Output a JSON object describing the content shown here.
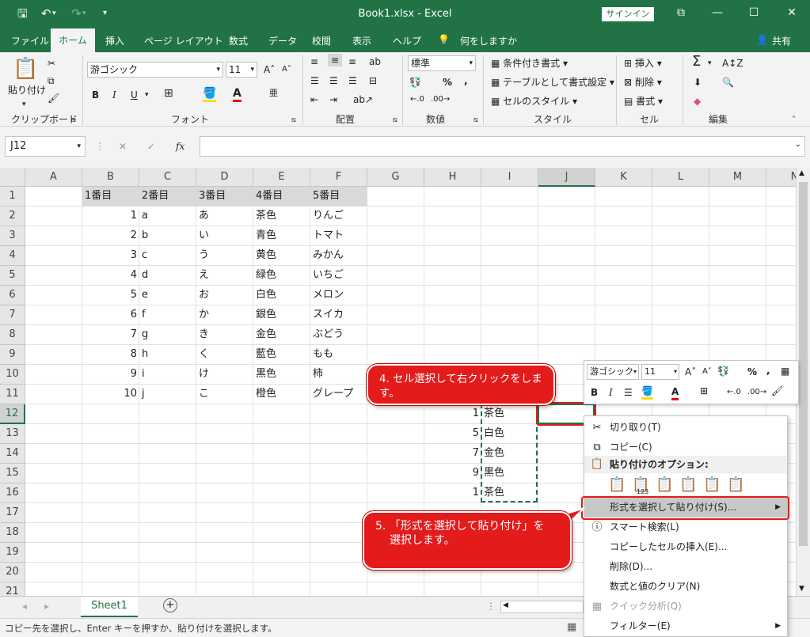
{
  "title_bar": {
    "title": "Book1.xlsx  -  Excel",
    "signin": "サインイン",
    "qat": {
      "save_icon": "save-icon",
      "undo_icon": "undo-icon",
      "redo_icon": "redo-icon",
      "customize": "▾"
    }
  },
  "menu": {
    "tabs": [
      "ファイル",
      "ホーム",
      "挿入",
      "ページ レイアウト",
      "数式",
      "データ",
      "校閲",
      "表示",
      "ヘルプ"
    ],
    "tell_me": "何をしますか",
    "share": "共有"
  },
  "ribbon": {
    "clipboard": {
      "paste": "貼り付け",
      "label": "クリップボード"
    },
    "font": {
      "name": "游ゴシック",
      "size": "11",
      "label": "フォント"
    },
    "alignment": {
      "label": "配置"
    },
    "number": {
      "format": "標準",
      "label": "数値",
      "percent": "%",
      "comma": ","
    },
    "styles": {
      "conditional": "条件付き書式",
      "table": "テーブルとして書式設定",
      "cell_styles": "セルのスタイル",
      "label": "スタイル"
    },
    "cells": {
      "insert": "挿入",
      "delete": "削除",
      "format": "書式",
      "label": "セル"
    },
    "editing": {
      "label": "編集"
    }
  },
  "formula_bar": {
    "name_box": "J12",
    "fx": "fx",
    "value": ""
  },
  "sheet": {
    "columns": [
      "A",
      "B",
      "C",
      "D",
      "E",
      "F",
      "G",
      "H",
      "I",
      "J",
      "K",
      "L",
      "M",
      "N"
    ],
    "rows": [
      "1",
      "2",
      "3",
      "4",
      "5",
      "6",
      "7",
      "8",
      "9",
      "10",
      "11",
      "12",
      "13",
      "14",
      "15",
      "16",
      "17",
      "18",
      "19",
      "20",
      "21"
    ],
    "header_row": [
      "1番目",
      "2番目",
      "3番目",
      "4番目",
      "5番目"
    ],
    "data": [
      [
        "1",
        "a",
        "あ",
        "茶色",
        "りんご"
      ],
      [
        "2",
        "b",
        "い",
        "青色",
        "トマト"
      ],
      [
        "3",
        "c",
        "う",
        "黄色",
        "みかん"
      ],
      [
        "4",
        "d",
        "え",
        "緑色",
        "いちご"
      ],
      [
        "5",
        "e",
        "お",
        "白色",
        "メロン"
      ],
      [
        "6",
        "f",
        "か",
        "銀色",
        "スイカ"
      ],
      [
        "7",
        "g",
        "き",
        "金色",
        "ぶどう"
      ],
      [
        "8",
        "h",
        "く",
        "藍色",
        "もも"
      ],
      [
        "9",
        "i",
        "け",
        "黒色",
        "柿"
      ],
      [
        "10",
        "j",
        "こ",
        "橙色",
        "グレープ"
      ]
    ],
    "copied": [
      [
        "1",
        "茶色"
      ],
      [
        "5",
        "白色"
      ],
      [
        "7",
        "金色"
      ],
      [
        "9",
        "黒色"
      ],
      [
        "1",
        "茶色"
      ]
    ],
    "selected_cell": "J12"
  },
  "sheet_tabs": {
    "active": "Sheet1",
    "add": "+"
  },
  "status": {
    "text": "コピー先を選択し、Enter キーを押すか、貼り付けを選択します。"
  },
  "mini_toolbar": {
    "font": "游ゴシック",
    "size": "11",
    "percent": "%",
    "comma": ","
  },
  "context_menu": {
    "items": [
      {
        "label": "切り取り(T)",
        "icon": "scissors-icon"
      },
      {
        "label": "コピー(C)",
        "icon": "copy-icon"
      },
      {
        "label": "貼り付けのオプション:",
        "icon": "paste-icon"
      },
      {
        "label": "形式を選択して貼り付け(S)...",
        "icon": ""
      },
      {
        "label": "スマート検索(L)",
        "icon": "smart-lookup-icon"
      },
      {
        "label": "コピーしたセルの挿入(E)...",
        "icon": ""
      },
      {
        "label": "削除(D)...",
        "icon": ""
      },
      {
        "label": "数式と値のクリア(N)",
        "icon": ""
      },
      {
        "label": "クイック分析(Q)",
        "icon": "quick-analysis-icon"
      },
      {
        "label": "フィルター(E)",
        "icon": ""
      }
    ],
    "paste_option_123": "123"
  },
  "callouts": {
    "step4": "4. セル選択して右クリックをします。",
    "step5_line1": "5. 「形式を選択して貼り付け」を",
    "step5_line2": "選択します。"
  },
  "colors": {
    "accent": "#217346",
    "callout": "#e31b1b"
  }
}
